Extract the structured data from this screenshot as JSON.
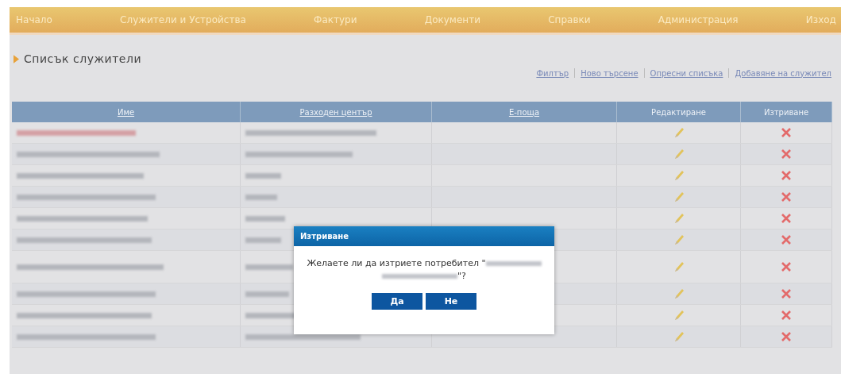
{
  "nav": [
    {
      "label": "Начало"
    },
    {
      "label": "Служители и Устройства"
    },
    {
      "label": "Фактури"
    },
    {
      "label": "Документи"
    },
    {
      "label": "Справки"
    },
    {
      "label": "Администрация"
    },
    {
      "label": "Изход"
    }
  ],
  "page_title": "Списък служители",
  "links": [
    {
      "label": "Филтър"
    },
    {
      "label": "Ново търсене"
    },
    {
      "label": "Опресни списъка"
    },
    {
      "label": "Добавяне на служител"
    }
  ],
  "table": {
    "columns": [
      {
        "label": "Име",
        "kind": "link"
      },
      {
        "label": "Разходен център",
        "kind": "link"
      },
      {
        "label": "Е-поща",
        "kind": "link"
      },
      {
        "label": "Редактиране",
        "kind": "plain"
      },
      {
        "label": "Изтриване",
        "kind": "plain"
      }
    ],
    "rows": [
      {
        "kind": "redacted",
        "tall": false
      },
      {
        "kind": "redacted",
        "tall": false
      },
      {
        "kind": "redacted",
        "tall": false
      },
      {
        "kind": "redacted",
        "tall": false
      },
      {
        "kind": "redacted",
        "tall": false
      },
      {
        "kind": "redacted",
        "tall": false
      },
      {
        "kind": "redacted",
        "tall": true
      },
      {
        "kind": "redacted",
        "tall": false
      },
      {
        "kind": "redacted",
        "tall": false
      },
      {
        "kind": "redacted",
        "tall": false
      }
    ]
  },
  "dialog": {
    "title": "Изтриване",
    "message_before": "Желаете ли да изтриете потребител \"",
    "message_after": "\"?",
    "buttons": [
      {
        "label": "Да"
      },
      {
        "label": "Не"
      }
    ]
  }
}
